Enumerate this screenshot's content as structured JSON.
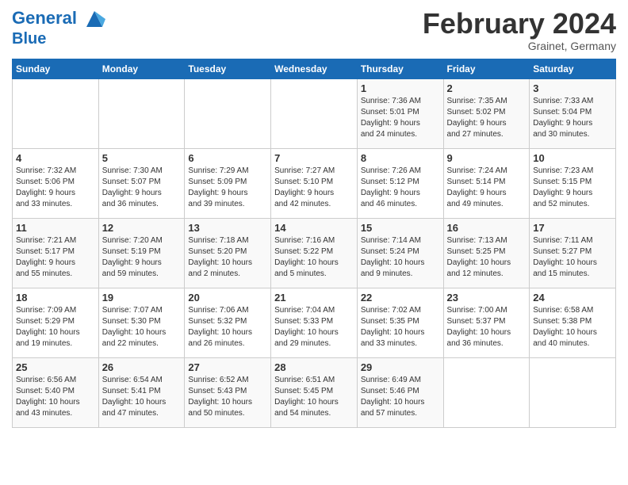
{
  "header": {
    "logo_line1": "General",
    "logo_line2": "Blue",
    "month": "February 2024",
    "location": "Grainet, Germany"
  },
  "days_of_week": [
    "Sunday",
    "Monday",
    "Tuesday",
    "Wednesday",
    "Thursday",
    "Friday",
    "Saturday"
  ],
  "weeks": [
    [
      {
        "num": "",
        "info": ""
      },
      {
        "num": "",
        "info": ""
      },
      {
        "num": "",
        "info": ""
      },
      {
        "num": "",
        "info": ""
      },
      {
        "num": "1",
        "info": "Sunrise: 7:36 AM\nSunset: 5:01 PM\nDaylight: 9 hours\nand 24 minutes."
      },
      {
        "num": "2",
        "info": "Sunrise: 7:35 AM\nSunset: 5:02 PM\nDaylight: 9 hours\nand 27 minutes."
      },
      {
        "num": "3",
        "info": "Sunrise: 7:33 AM\nSunset: 5:04 PM\nDaylight: 9 hours\nand 30 minutes."
      }
    ],
    [
      {
        "num": "4",
        "info": "Sunrise: 7:32 AM\nSunset: 5:06 PM\nDaylight: 9 hours\nand 33 minutes."
      },
      {
        "num": "5",
        "info": "Sunrise: 7:30 AM\nSunset: 5:07 PM\nDaylight: 9 hours\nand 36 minutes."
      },
      {
        "num": "6",
        "info": "Sunrise: 7:29 AM\nSunset: 5:09 PM\nDaylight: 9 hours\nand 39 minutes."
      },
      {
        "num": "7",
        "info": "Sunrise: 7:27 AM\nSunset: 5:10 PM\nDaylight: 9 hours\nand 42 minutes."
      },
      {
        "num": "8",
        "info": "Sunrise: 7:26 AM\nSunset: 5:12 PM\nDaylight: 9 hours\nand 46 minutes."
      },
      {
        "num": "9",
        "info": "Sunrise: 7:24 AM\nSunset: 5:14 PM\nDaylight: 9 hours\nand 49 minutes."
      },
      {
        "num": "10",
        "info": "Sunrise: 7:23 AM\nSunset: 5:15 PM\nDaylight: 9 hours\nand 52 minutes."
      }
    ],
    [
      {
        "num": "11",
        "info": "Sunrise: 7:21 AM\nSunset: 5:17 PM\nDaylight: 9 hours\nand 55 minutes."
      },
      {
        "num": "12",
        "info": "Sunrise: 7:20 AM\nSunset: 5:19 PM\nDaylight: 9 hours\nand 59 minutes."
      },
      {
        "num": "13",
        "info": "Sunrise: 7:18 AM\nSunset: 5:20 PM\nDaylight: 10 hours\nand 2 minutes."
      },
      {
        "num": "14",
        "info": "Sunrise: 7:16 AM\nSunset: 5:22 PM\nDaylight: 10 hours\nand 5 minutes."
      },
      {
        "num": "15",
        "info": "Sunrise: 7:14 AM\nSunset: 5:24 PM\nDaylight: 10 hours\nand 9 minutes."
      },
      {
        "num": "16",
        "info": "Sunrise: 7:13 AM\nSunset: 5:25 PM\nDaylight: 10 hours\nand 12 minutes."
      },
      {
        "num": "17",
        "info": "Sunrise: 7:11 AM\nSunset: 5:27 PM\nDaylight: 10 hours\nand 15 minutes."
      }
    ],
    [
      {
        "num": "18",
        "info": "Sunrise: 7:09 AM\nSunset: 5:29 PM\nDaylight: 10 hours\nand 19 minutes."
      },
      {
        "num": "19",
        "info": "Sunrise: 7:07 AM\nSunset: 5:30 PM\nDaylight: 10 hours\nand 22 minutes."
      },
      {
        "num": "20",
        "info": "Sunrise: 7:06 AM\nSunset: 5:32 PM\nDaylight: 10 hours\nand 26 minutes."
      },
      {
        "num": "21",
        "info": "Sunrise: 7:04 AM\nSunset: 5:33 PM\nDaylight: 10 hours\nand 29 minutes."
      },
      {
        "num": "22",
        "info": "Sunrise: 7:02 AM\nSunset: 5:35 PM\nDaylight: 10 hours\nand 33 minutes."
      },
      {
        "num": "23",
        "info": "Sunrise: 7:00 AM\nSunset: 5:37 PM\nDaylight: 10 hours\nand 36 minutes."
      },
      {
        "num": "24",
        "info": "Sunrise: 6:58 AM\nSunset: 5:38 PM\nDaylight: 10 hours\nand 40 minutes."
      }
    ],
    [
      {
        "num": "25",
        "info": "Sunrise: 6:56 AM\nSunset: 5:40 PM\nDaylight: 10 hours\nand 43 minutes."
      },
      {
        "num": "26",
        "info": "Sunrise: 6:54 AM\nSunset: 5:41 PM\nDaylight: 10 hours\nand 47 minutes."
      },
      {
        "num": "27",
        "info": "Sunrise: 6:52 AM\nSunset: 5:43 PM\nDaylight: 10 hours\nand 50 minutes."
      },
      {
        "num": "28",
        "info": "Sunrise: 6:51 AM\nSunset: 5:45 PM\nDaylight: 10 hours\nand 54 minutes."
      },
      {
        "num": "29",
        "info": "Sunrise: 6:49 AM\nSunset: 5:46 PM\nDaylight: 10 hours\nand 57 minutes."
      },
      {
        "num": "",
        "info": ""
      },
      {
        "num": "",
        "info": ""
      }
    ]
  ]
}
